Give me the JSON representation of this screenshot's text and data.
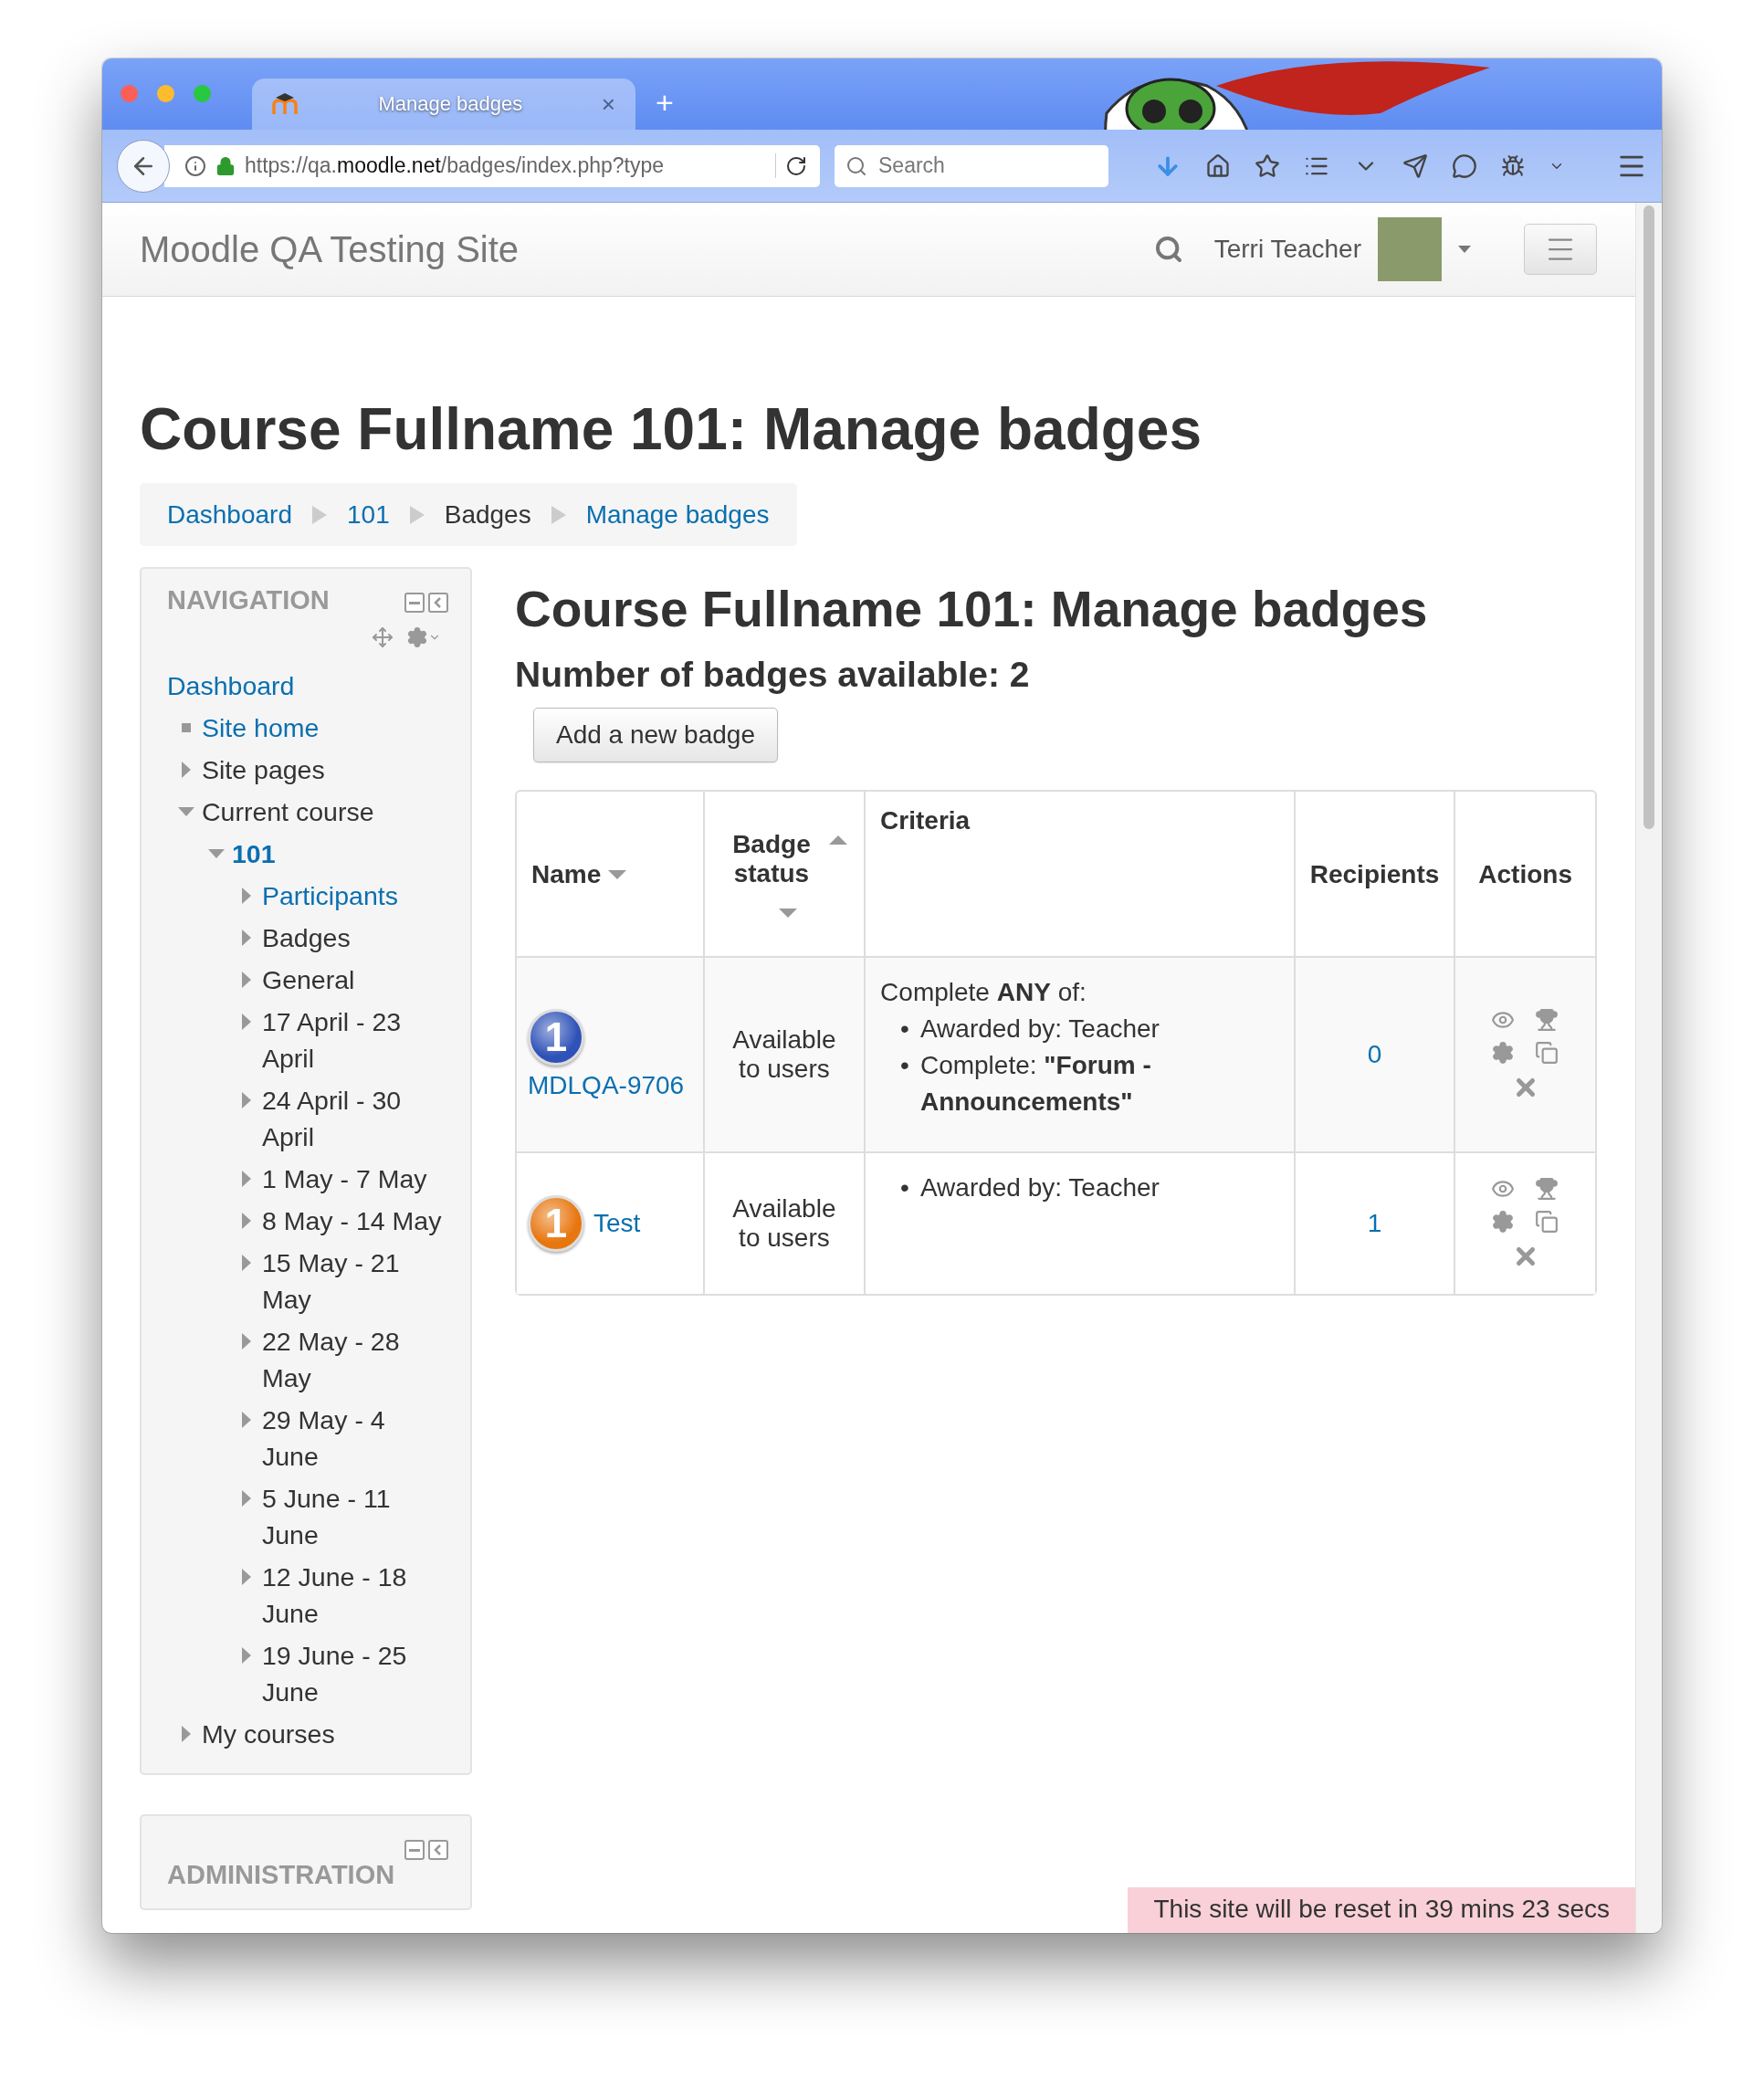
{
  "browser": {
    "tab_title": "Manage badges",
    "tab_close": "×",
    "new_tab": "+",
    "url_prefix": "https://qa.",
    "url_domain": "moodle.net",
    "url_path": "/badges/index.php?type",
    "search_placeholder": "Search"
  },
  "navbar": {
    "site_name": "Moodle QA Testing Site",
    "user_name": "Terri Teacher"
  },
  "page_title": "Course Fullname 101: Manage badges",
  "breadcrumb": [
    {
      "label": "Dashboard",
      "link": true
    },
    {
      "label": "101",
      "link": true
    },
    {
      "label": "Badges",
      "link": false
    },
    {
      "label": "Manage badges",
      "link": true
    }
  ],
  "navigation": {
    "title": "NAVIGATION",
    "items": [
      {
        "label": "Dashboard",
        "kind": "root",
        "link": true,
        "current": false,
        "children": [
          {
            "label": "Site home",
            "kind": "leaf",
            "link": true,
            "current": false
          },
          {
            "label": "Site pages",
            "kind": "branch",
            "expanded": false,
            "link": false,
            "current": false
          },
          {
            "label": "Current course",
            "kind": "branch",
            "expanded": true,
            "link": false,
            "current": false,
            "children": [
              {
                "label": "101",
                "kind": "branch",
                "expanded": true,
                "link": true,
                "current": true,
                "children": [
                  {
                    "label": "Participants",
                    "kind": "branch",
                    "expanded": false,
                    "link": true,
                    "current": false
                  },
                  {
                    "label": "Badges",
                    "kind": "branch",
                    "expanded": false,
                    "link": false,
                    "current": false
                  },
                  {
                    "label": "General",
                    "kind": "branch",
                    "expanded": false,
                    "link": false,
                    "current": false
                  },
                  {
                    "label": "17 April - 23 April",
                    "kind": "branch",
                    "expanded": false,
                    "link": false,
                    "current": false
                  },
                  {
                    "label": "24 April - 30 April",
                    "kind": "branch",
                    "expanded": false,
                    "link": false,
                    "current": false
                  },
                  {
                    "label": "1 May - 7 May",
                    "kind": "branch",
                    "expanded": false,
                    "link": false,
                    "current": false
                  },
                  {
                    "label": "8 May - 14 May",
                    "kind": "branch",
                    "expanded": false,
                    "link": false,
                    "current": false
                  },
                  {
                    "label": "15 May - 21 May",
                    "kind": "branch",
                    "expanded": false,
                    "link": false,
                    "current": false
                  },
                  {
                    "label": "22 May - 28 May",
                    "kind": "branch",
                    "expanded": false,
                    "link": false,
                    "current": false
                  },
                  {
                    "label": "29 May - 4 June",
                    "kind": "branch",
                    "expanded": false,
                    "link": false,
                    "current": false
                  },
                  {
                    "label": "5 June - 11 June",
                    "kind": "branch",
                    "expanded": false,
                    "link": false,
                    "current": false
                  },
                  {
                    "label": "12 June - 18 June",
                    "kind": "branch",
                    "expanded": false,
                    "link": false,
                    "current": false
                  },
                  {
                    "label": "19 June - 25 June",
                    "kind": "branch",
                    "expanded": false,
                    "link": false,
                    "current": false
                  }
                ]
              }
            ]
          },
          {
            "label": "My courses",
            "kind": "branch",
            "expanded": false,
            "link": false,
            "current": false
          }
        ]
      }
    ]
  },
  "administration": {
    "title": "ADMINISTRATION"
  },
  "main": {
    "heading": "Course Fullname 101: Manage badges",
    "count_text": "Number of badges available: 2",
    "add_button": "Add a new badge"
  },
  "table": {
    "columns": [
      {
        "label": "Name",
        "sort_up": false,
        "sort_down": true
      },
      {
        "label": "Badge status",
        "sort_up": true,
        "sort_down": true
      },
      {
        "label": "Criteria",
        "sort_up": false,
        "sort_down": false
      },
      {
        "label": "Recipients",
        "sort_up": false,
        "sort_down": false
      },
      {
        "label": "Actions",
        "sort_up": false,
        "sort_down": false
      }
    ],
    "rows": [
      {
        "badge_number": "1",
        "color": "#2f52b8",
        "name": "MDLQA-9706",
        "status": "Available to users",
        "criteria_intro": "Complete **ANY** of:",
        "criteria": [
          {
            "bullet": "•",
            "text": "Awarded by: Teacher"
          },
          {
            "bullet": "•",
            "text": "Complete: **\"Forum - Announcements\"**"
          }
        ],
        "recipients": "0"
      },
      {
        "badge_number": "1",
        "color": "#e8760e",
        "name": "Test",
        "status": "Available to users",
        "criteria": [
          {
            "bullet": "•",
            "text": "Awarded by: Teacher"
          }
        ],
        "recipients": "1"
      }
    ]
  },
  "reset_notice": "This site will be reset in 39 mins 23 secs"
}
